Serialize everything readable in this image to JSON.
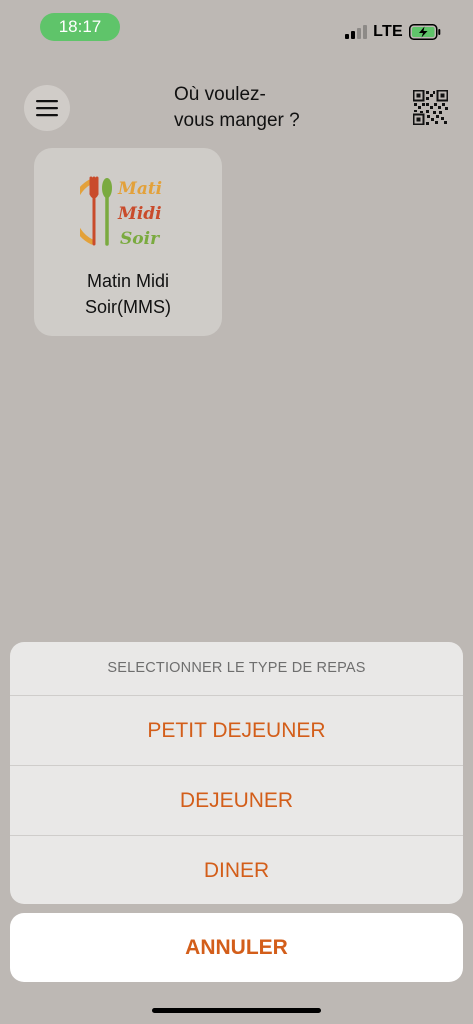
{
  "status_bar": {
    "time": "18:17",
    "network": "LTE",
    "icons": [
      "signal-icon",
      "battery-charging-icon"
    ]
  },
  "header": {
    "title_line1": "Où voulez-",
    "title_line2": "vous manger ?",
    "icons": [
      "menu-icon",
      "qr-code-icon"
    ]
  },
  "restaurants": [
    {
      "name_line1": "Matin Midi",
      "name_line2": "Soir(MMS)",
      "logo": {
        "line1": "Mati",
        "line2": "Midi",
        "line3": "Soir"
      }
    }
  ],
  "action_sheet": {
    "title": "SELECTIONNER LE TYPE DE REPAS",
    "options": [
      "PETIT DEJEUNER",
      "DEJEUNER",
      "DINER"
    ],
    "cancel_label": "ANNULER"
  },
  "colors": {
    "accent": "#d35e1a",
    "background": "#bdb8b4",
    "time_pill": "#5fc46a"
  }
}
